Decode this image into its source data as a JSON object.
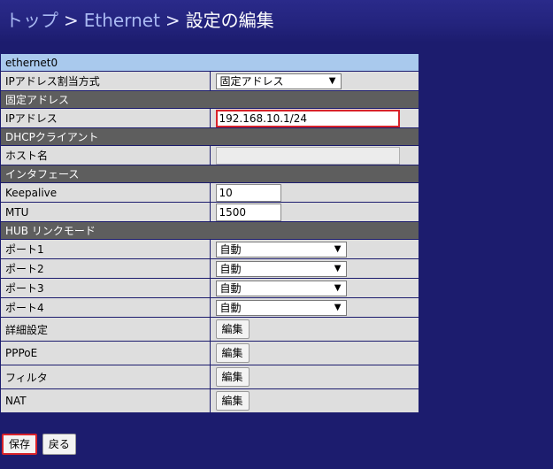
{
  "breadcrumb": {
    "top": "トップ",
    "sep1": ">",
    "ethernet": "Ethernet",
    "sep2": ">",
    "current": "設定の編集"
  },
  "interface_name": "ethernet0",
  "ip_assign": {
    "label": "IPアドレス割当方式",
    "value": "固定アドレス"
  },
  "sections": {
    "static": "固定アドレス",
    "dhcp": "DHCPクライアント",
    "iface": "インタフェース",
    "hub": "HUB リンクモード"
  },
  "ip_address": {
    "label": "IPアドレス",
    "value": "192.168.10.1/24"
  },
  "hostname": {
    "label": "ホスト名",
    "value": ""
  },
  "keepalive": {
    "label": "Keepalive",
    "value": "10"
  },
  "mtu": {
    "label": "MTU",
    "value": "1500"
  },
  "ports": [
    {
      "label": "ポート1",
      "value": "自動"
    },
    {
      "label": "ポート2",
      "value": "自動"
    },
    {
      "label": "ポート3",
      "value": "自動"
    },
    {
      "label": "ポート4",
      "value": "自動"
    }
  ],
  "edit_rows": [
    {
      "label": "詳細設定",
      "button": "編集"
    },
    {
      "label": "PPPoE",
      "button": "編集"
    },
    {
      "label": "フィルタ",
      "button": "編集"
    },
    {
      "label": "NAT",
      "button": "編集"
    }
  ],
  "buttons": {
    "save": "保存",
    "back": "戻る"
  },
  "dropdown_arrow": "▼",
  "colors": {
    "page_bg": "#1c1c6e",
    "title_row": "#a9c9ed",
    "section_row": "#5e5e5e",
    "row_bg": "#dedede",
    "highlight": "#d8232a",
    "link": "#a9b9f2"
  }
}
